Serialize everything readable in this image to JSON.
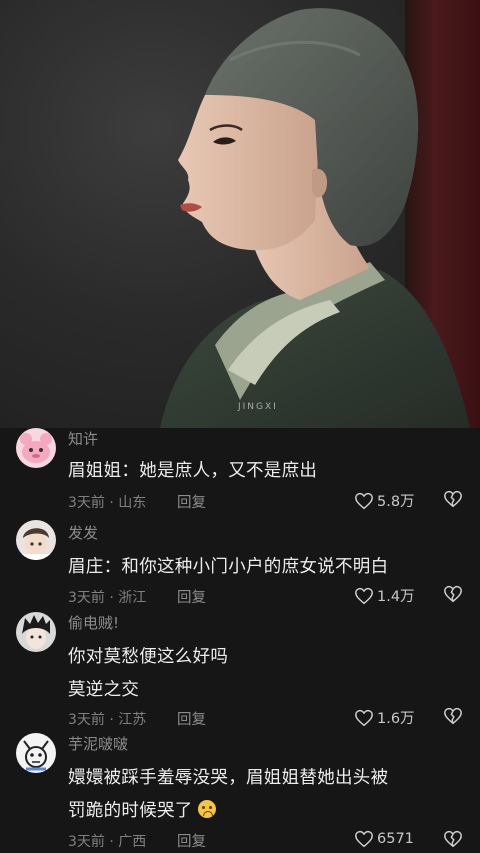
{
  "hero": {
    "watermark": "JINGXI"
  },
  "comments": [
    {
      "username": "知许",
      "lines": [
        "眉姐姐：她是庶人，又不是庶出"
      ],
      "time": "3天前",
      "location": "山东",
      "reply": "回复",
      "likes": "5.8万"
    },
    {
      "username": "发发",
      "lines": [
        "眉庄：和你这种小门小户的庶女说不明白"
      ],
      "time": "3天前",
      "location": "浙江",
      "reply": "回复",
      "likes": "1.4万"
    },
    {
      "username": "偷电贼!",
      "lines": [
        "你对莫愁便这么好吗",
        "莫逆之交"
      ],
      "time": "3天前",
      "location": "江苏",
      "reply": "回复",
      "likes": "1.6万"
    },
    {
      "username": "芋泥啵啵",
      "lines": [
        "嬛嬛被踩手羞辱没哭，眉姐姐替她出头被",
        "罚跪的时候哭了"
      ],
      "time": "3天前",
      "location": "广西",
      "reply": "回复",
      "likes": "6571"
    }
  ],
  "meta_separator": "·",
  "icons": {
    "like": "heart-outline-icon",
    "dislike": "broken-heart-icon",
    "emoji": "crying-face-emoji"
  }
}
